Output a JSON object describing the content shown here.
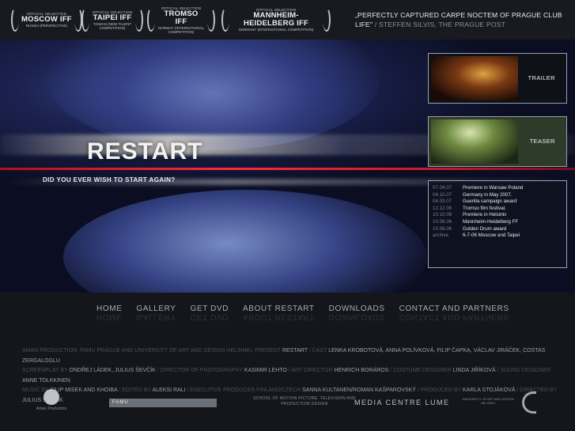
{
  "festivals": [
    {
      "selection": "OFFICIAL SELECTION",
      "name": "MOSCOW IFF",
      "sub": "RUSSIA (PERSPECTIVE)"
    },
    {
      "selection": "OFFICIAL SELECTION",
      "name": "TAIPEI IFF",
      "sub": "TAIWAN (NEW TALENT COMPETITION)"
    },
    {
      "selection": "OFFICIAL SELECTION",
      "name": "TROMSO IFF",
      "sub": "NORWAY (INTERNATIONAL COMPETITION)"
    },
    {
      "selection": "OFFICIAL SELECTION",
      "name": "MANNHEIM-HEIDELBERG IFF",
      "sub": "GERMANY (INTERNATIONAL COMPETITION)"
    }
  ],
  "quote": {
    "text": "„PERFECTLY CAPTURED CARPE NOCTEM OF PRAGUE CLUB LIFE\"",
    "sep": " / ",
    "attribution": "STEFFEN SILVIS, THE PRAGUE POST"
  },
  "hero": {
    "title": "RESTART",
    "tagline": "DID YOU EVER WISH TO START AGAIN?"
  },
  "thumbs": {
    "trailer": "TRAILER",
    "teaser": "TEASER"
  },
  "news": [
    {
      "date": "07.04.07",
      "text": "Premiere in Warsaw Poland"
    },
    {
      "date": "04.10.07",
      "text": "Germany in May 2007."
    },
    {
      "date": "04.03.07",
      "text": "Guerilla campaign award"
    },
    {
      "date": "12.12.06",
      "text": "Tromso film festival."
    },
    {
      "date": "10.10.06",
      "text": "Premiere in Helsinki"
    },
    {
      "date": "10.06.06",
      "text": "Mannheim-Heidelberg FF"
    },
    {
      "date": "10.06.06",
      "text": "Golden Drum award"
    },
    {
      "date": "archive",
      "text": "6-7-06 Moscow and Taipei"
    }
  ],
  "nav": [
    "HOME",
    "GALLERY",
    "GET DVD",
    "ABOUT RESTART",
    "DOWNLOADS",
    "CONTACT AND PARTNERS"
  ],
  "credits": {
    "l1a": "AMAN PRODUCTION, FAMU PRAGUE AND UNIVERSITY OF ART AND DESIGN HELSINKI, PRESENT",
    "l1b": "RESTART",
    "l1c": "/ CAST",
    "l1d": "LENKA KROBOTOVÁ, ANNA POLÍVKOVÁ, FILIP ČAPKA, VÁCLAV JIRÁČEK, COSTAS ZERGALOGLU",
    "l2a": "SCREENPLAY BY",
    "l2b": "ONDŘEJ LÁDEK, JULIUS ŠEVČÍK",
    "l2c": "/ DIRECTOR OF PHOTOGRAPHY",
    "l2d": "KASIMIR LEHTO",
    "l2e": "/ ART DIRECTOR",
    "l2f": "HENRICH BORÁROS",
    "l2g": "/ COSTUME DESIGNER",
    "l2h": "LINDA JIŘÍKOVÁ",
    "l2i": "/ SOUND DESIGNER",
    "l2j": "ANNE TOLKKINEN",
    "l3a": "MUSIC BY",
    "l3b": "FILIP MISEK AND KHOIBA",
    "l3c": "/ EDITED BY",
    "l3d": "ALEKSI RALI",
    "l3e": "/ EXECUTIVE PRODUCER FINLAND/CZECH",
    "l3f": "SANNA KULTANEN/ROMAN KAŠPAROVSKÝ",
    "l3g": "/ PRODUCED BY",
    "l3h": "KARLA STOJÁKOVÁ",
    "l3i": "/ DIRECTED BY",
    "l3j": "JULIUS ŠEVČÍK"
  },
  "logos": {
    "aman": "Aman Production",
    "famu": "FAMU",
    "school": "SCHOOL OF MOTION PICTURE, TELEVISION AND PRODUCTION DESIGN",
    "mcl": "MEDIA CENTRE LUME",
    "uiah": "UNIVERSITY OF ART AND DESIGN HELSINKI"
  }
}
